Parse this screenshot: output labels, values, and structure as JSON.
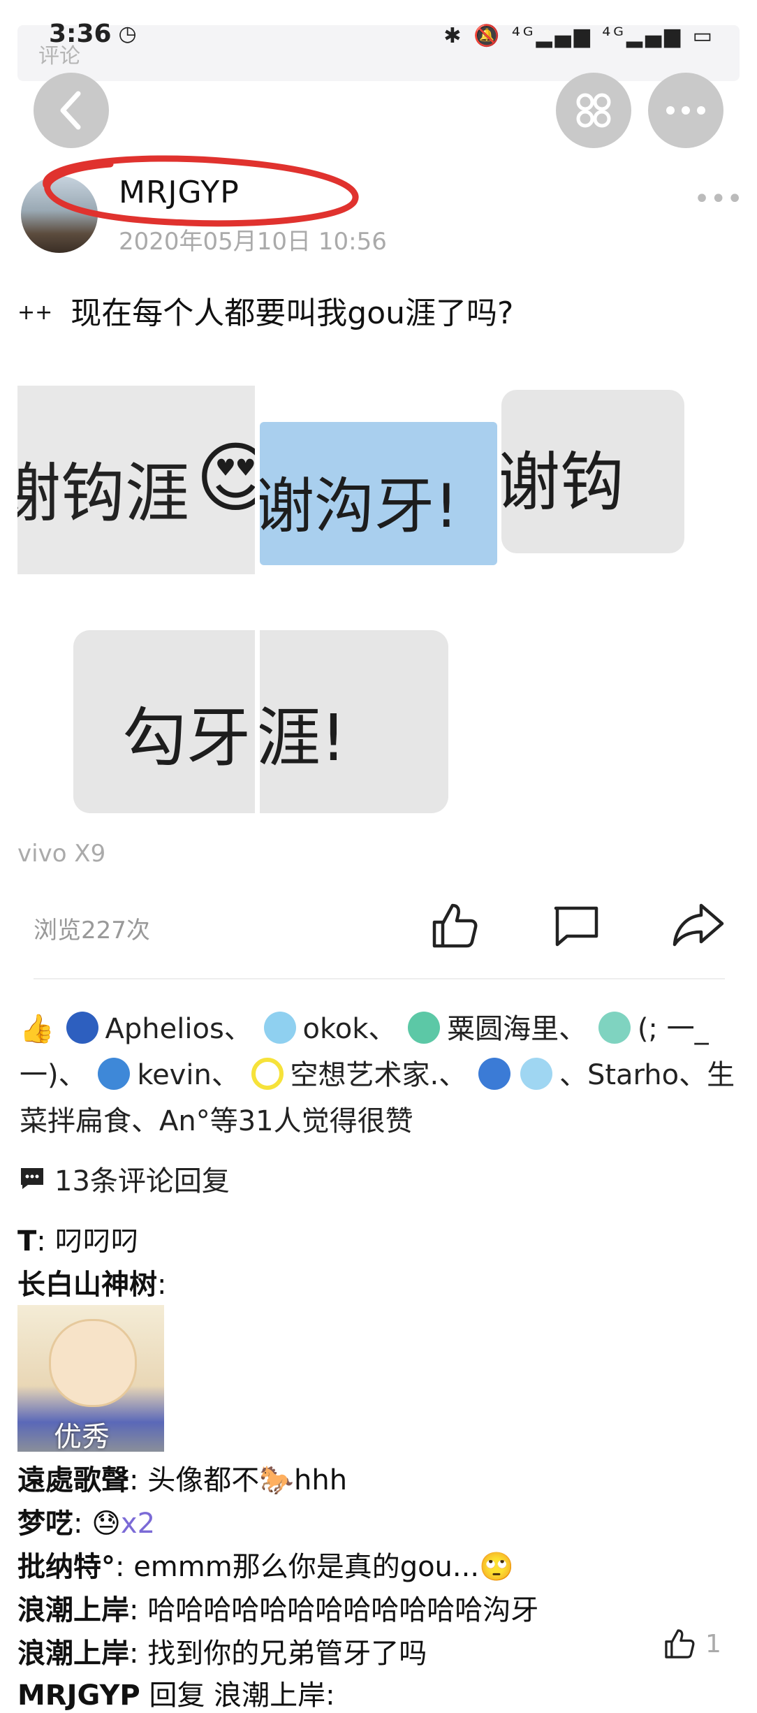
{
  "status_bar": {
    "time": "3:36",
    "right_icons": "✱ 🔕 ⁴ᴳ▂▄▆ ⁴ᴳ▂▄▆ ▭"
  },
  "top_ghost_text": "评论",
  "post": {
    "username": "MRJGYP",
    "date": "2020年05月10日 10:56",
    "text": "现在每个人都要叫我gou涯了吗?",
    "text_symbol": "++",
    "images": [
      {
        "text": "谢钩涯",
        "emoji": "😍"
      },
      {
        "text": "谢沟牙!"
      },
      {
        "text": "谢钩"
      },
      {
        "text": "勾牙"
      },
      {
        "text": "涯!"
      }
    ],
    "device": "vivo X9",
    "views": "浏览227次"
  },
  "likes": {
    "names_part1": "Aphelios、",
    "names_part2": "okok、",
    "names_part3": "粟圆海里、",
    "names_part4": "(;  一_一)、",
    "names_part5": "kevin、",
    "names_part6": "空想艺术家.、",
    "names_part7": "、Starho、生菜拌扁食、An°等31人觉得很赞"
  },
  "comments_count": "13条评论回复",
  "comments": [
    {
      "author": "T",
      "text": ": 叼叼叼"
    },
    {
      "author": "长白山神树",
      "text": ":"
    },
    {
      "author": "遠處歌聲",
      "text": ": 头像都不🐎hhh"
    },
    {
      "author": "梦呓",
      "text": ": 😓",
      "extra": "x2"
    },
    {
      "author": "批纳特°",
      "text": ": emmm那么你是真的gou...🙄"
    },
    {
      "author": "浪潮上岸",
      "text": ": 哈哈哈哈哈哈哈哈哈哈哈哈沟牙"
    },
    {
      "author": "浪潮上岸",
      "text": ": 找到你的兄弟管牙了吗",
      "likes": "1"
    },
    {
      "author": "MRJGYP",
      "text": " 回复 浪潮上岸:"
    }
  ],
  "sticker_caption": "优秀",
  "colors": {
    "accent_red": "#e0322e",
    "muted": "#aaaaaa",
    "button_bg": "#c9c9c9",
    "link_purple": "#7b6ad6"
  }
}
